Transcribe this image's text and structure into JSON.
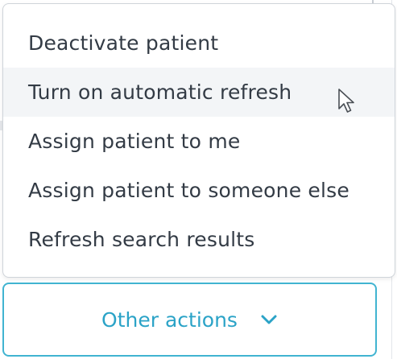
{
  "menu": {
    "items": [
      {
        "label": "Deactivate patient"
      },
      {
        "label": "Turn on automatic refresh"
      },
      {
        "label": "Assign patient to me"
      },
      {
        "label": "Assign patient to someone else"
      },
      {
        "label": "Refresh search results"
      }
    ]
  },
  "button": {
    "label": "Other actions",
    "icon": "chevron-down-icon",
    "color": "#2ba3c7",
    "border_color": "#41b4d1"
  },
  "cursor": {
    "icon": "mouse-pointer-icon"
  }
}
